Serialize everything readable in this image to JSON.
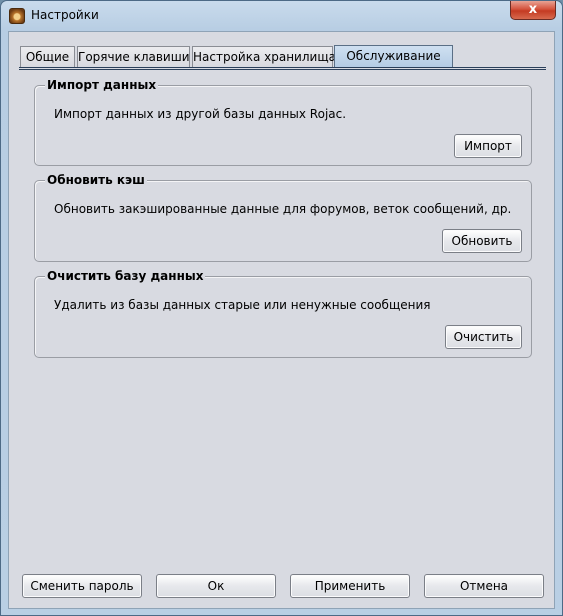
{
  "window": {
    "title": "Настройки",
    "close_label": "x"
  },
  "tabs": [
    {
      "label": "Общие",
      "active": false
    },
    {
      "label": "Горячие клавиши",
      "active": false
    },
    {
      "label": "Настройка хранилища",
      "active": false
    },
    {
      "label": "Обслуживание",
      "active": true
    }
  ],
  "groups": [
    {
      "title": "Импорт данных",
      "description": "Импорт данных из другой базы данных Rojac.",
      "button": "Импорт"
    },
    {
      "title": "Обновить кэш",
      "description": "Обновить закэшированные данные для форумов, веток сообщений, др.",
      "button": "Обновить"
    },
    {
      "title": "Очистить базу данных",
      "description": "Удалить из базы данных старые или ненужные сообщения",
      "button": "Очистить"
    }
  ],
  "footer": {
    "change_password": "Сменить пароль",
    "ok": "Ок",
    "apply": "Применить",
    "cancel": "Отмена"
  },
  "colors": {
    "active_tab": "#b3cbe4",
    "client_bg": "#d8dae1",
    "close_button": "#c43a22"
  }
}
